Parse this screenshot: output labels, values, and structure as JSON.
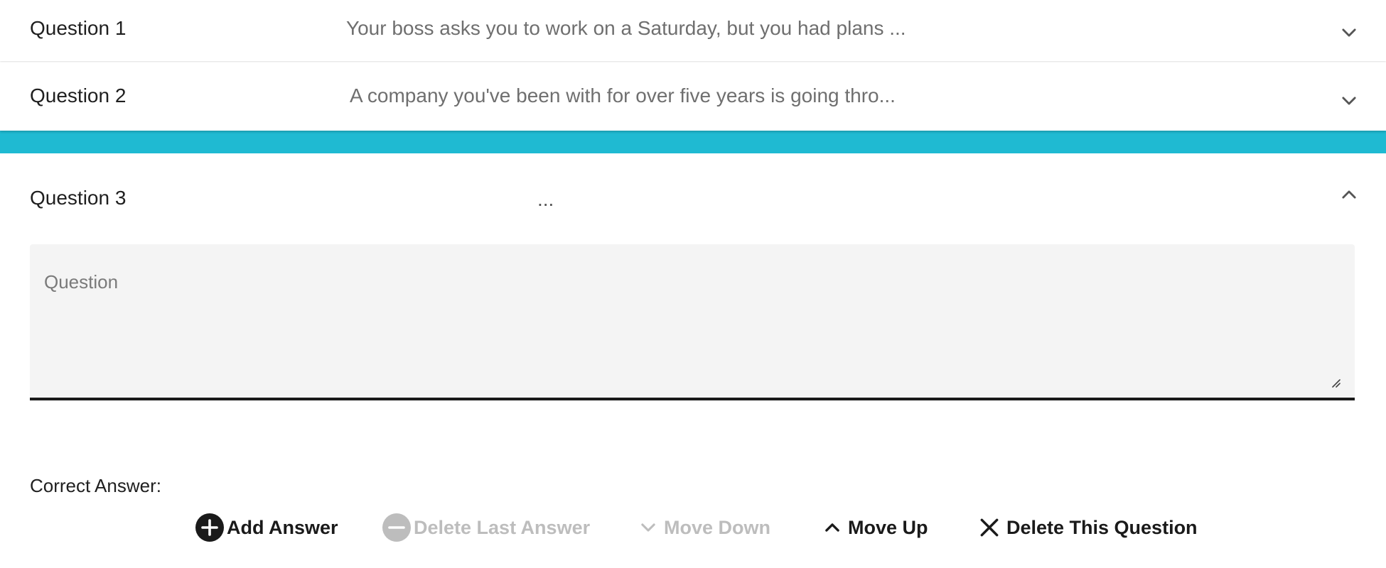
{
  "questions": [
    {
      "label": "Question 1",
      "preview": "Your boss asks you to work on a Saturday, but you had plans ...",
      "expanded": false
    },
    {
      "label": "Question 2",
      "preview": "A company you've been with for over five years is going thro...",
      "expanded": false
    },
    {
      "label": "Question 3",
      "preview": "...",
      "expanded": true
    }
  ],
  "editor": {
    "question_placeholder": "Question",
    "question_value": "",
    "correct_answer_label": "Correct Answer:"
  },
  "actions": {
    "add_answer": "Add Answer",
    "delete_last_answer": "Delete Last Answer",
    "move_down": "Move Down",
    "move_up": "Move Up",
    "delete_question": "Delete This Question"
  },
  "colors": {
    "accent": "#1fbad2",
    "text": "#1f1f1f",
    "muted": "#6f6f6f",
    "disabled": "#bdbdbd",
    "field_bg": "#f4f4f4"
  },
  "icons": {
    "collapsed": "chevron-down-icon",
    "expanded": "chevron-up-icon",
    "add": "plus-circle-icon",
    "delete_answer": "minus-circle-icon",
    "move_down": "chevron-down-icon",
    "move_up": "chevron-up-icon",
    "delete_question": "close-icon"
  }
}
